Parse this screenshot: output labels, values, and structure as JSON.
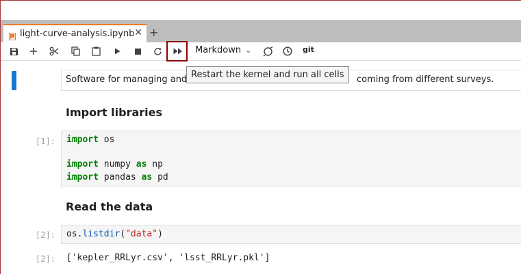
{
  "notebook": {
    "tab_title": "light-curve-analysis.ipynb",
    "close_glyph": "✕",
    "new_tab_glyph": "+"
  },
  "toolbar": {
    "cell_type": "Markdown",
    "git_label": "git",
    "icons": [
      "save-icon",
      "add-cell-icon",
      "cut-icon",
      "copy-icon",
      "paste-icon",
      "run-icon",
      "stop-icon",
      "restart-icon",
      "restart-run-all-icon",
      "chevron-down-icon",
      "kernel-status-icon",
      "history-icon",
      "git-icon"
    ]
  },
  "tooltip": "Restart the kernel and run all cells",
  "cells": {
    "markdown_intro_a": "Software for managing and",
    "markdown_intro_b": "coming from different surveys.",
    "heading_import": "Import libraries",
    "heading_read": "Read the data",
    "cell1": {
      "prompt": "[1]:",
      "lines": [
        {
          "kw": "import",
          "rest": " os"
        },
        {
          "kw": "import",
          "mid": " numpy ",
          "kw2": "as",
          "rest": " np"
        },
        {
          "kw": "import",
          "mid": " pandas ",
          "kw2": "as",
          "rest": " pd"
        }
      ]
    },
    "cell2": {
      "prompt": "[2]:",
      "obj": "os",
      "dot": ".",
      "fn": "listdir",
      "open": "(",
      "arg": "\"data\"",
      "close": ")"
    },
    "output2": {
      "prompt": "[2]:",
      "text": "['kepler_RRLyr.csv', 'lsst_RRLyr.pkl']"
    }
  },
  "colors": {
    "accent": "#1976d2",
    "tab_orange": "#f37726",
    "highlight_box": "#8b0000"
  }
}
